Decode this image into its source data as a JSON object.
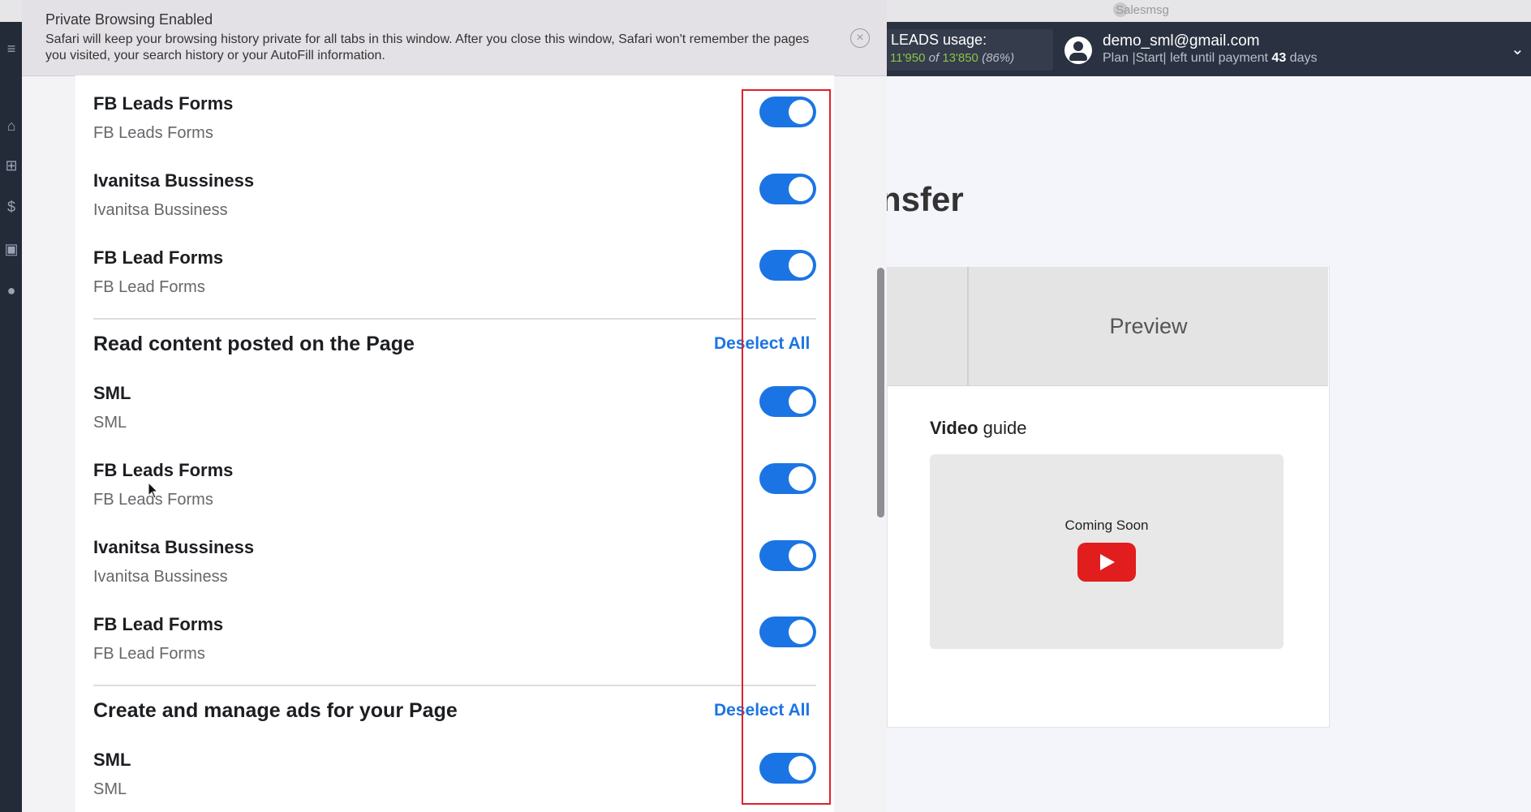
{
  "app_titlebar": {
    "title": "Salesmsg"
  },
  "header": {
    "usage_label": "LEADS usage:",
    "usage_used": "11'950",
    "usage_of": "of",
    "usage_total": "13'850",
    "usage_percent": "(86%)",
    "user_email": "demo_sml@gmail.com",
    "plan_text": "Plan |Start| left until payment",
    "days_left": "43",
    "days_unit": "days"
  },
  "background_page": {
    "heading": "nsfer",
    "tab_preview": "Preview",
    "video_title_bold": "Video",
    "video_title_rest": "guide",
    "video_placeholder": "Coming Soon"
  },
  "private_banner": {
    "title": "Private Browsing Enabled",
    "text": "Safari will keep your browsing history private for all tabs in this window. After you close this window, Safari won't remember the pages you visited, your search history or your AutoFill information."
  },
  "permissions": {
    "group1_items": [
      {
        "title": "FB Leads Forms",
        "subtitle": "FB Leads Forms",
        "enabled": true
      },
      {
        "title": "Ivanitsa Bussiness",
        "subtitle": "Ivanitsa Bussiness",
        "enabled": true
      },
      {
        "title": "FB Lead Forms",
        "subtitle": "FB Lead Forms",
        "enabled": true
      }
    ],
    "section_read": {
      "title": "Read content posted on the Page",
      "deselect": "Deselect All",
      "items": [
        {
          "title": "SML",
          "subtitle": "SML",
          "enabled": true
        },
        {
          "title": "FB Leads Forms",
          "subtitle": "FB Leads Forms",
          "enabled": true
        },
        {
          "title": "Ivanitsa Bussiness",
          "subtitle": "Ivanitsa Bussiness",
          "enabled": true
        },
        {
          "title": "FB Lead Forms",
          "subtitle": "FB Lead Forms",
          "enabled": true
        }
      ]
    },
    "section_ads": {
      "title": "Create and manage ads for your Page",
      "deselect": "Deselect All",
      "items": [
        {
          "title": "SML",
          "subtitle": "SML",
          "enabled": true
        }
      ]
    }
  },
  "colors": {
    "toggle_on": "#1b74e4",
    "highlight_border": "#e0202a",
    "usage_green": "#8bc34a",
    "topbar": "#2a3140"
  }
}
